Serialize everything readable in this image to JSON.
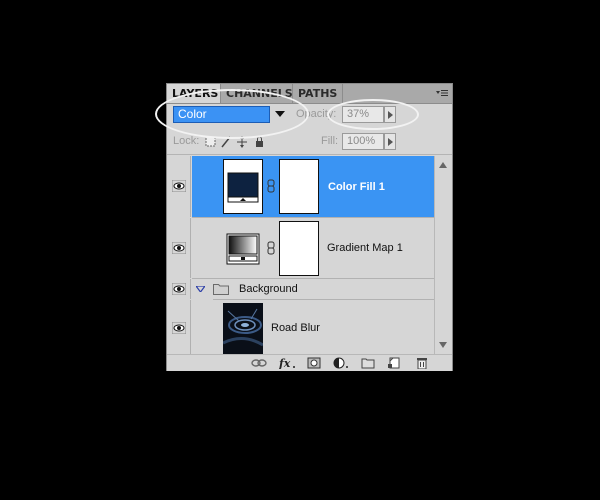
{
  "tabs": [
    {
      "label": "LAYERS"
    },
    {
      "label": "CHANNELS"
    },
    {
      "label": "PATHS"
    }
  ],
  "blend_mode": {
    "value": "Color"
  },
  "opacity": {
    "label": "Opacity:",
    "value": "37%"
  },
  "lock": {
    "label": "Lock:"
  },
  "fill": {
    "label": "Fill:",
    "value": "100%"
  },
  "layers": [
    {
      "name": "Color Fill 1",
      "selected": true
    },
    {
      "name": "Gradient Map 1",
      "selected": false
    },
    {
      "name": "Background",
      "type": "group"
    },
    {
      "name": "Road Blur",
      "selected": false
    }
  ],
  "colors": {
    "selection": "#3a94f3",
    "fill_swatch": "#0d2240",
    "annotation": "#f2f2f2"
  },
  "icons": [
    "eye-icon",
    "chain-link-icon",
    "folder-icon",
    "fx-icon",
    "mask-icon",
    "adjustment-icon",
    "new-group-icon",
    "new-layer-icon",
    "trash-icon"
  ]
}
